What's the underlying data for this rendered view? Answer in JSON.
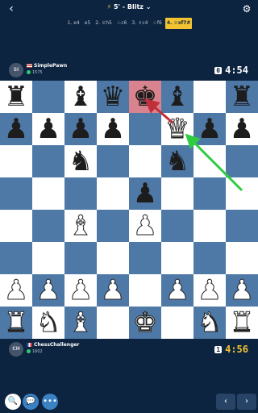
{
  "header": {
    "back_icon": "chevron-left-icon",
    "title": "5' - Blitz",
    "title_icon": "lightning-icon",
    "settings_icon": "gear-icon"
  },
  "moves": [
    "1. e4",
    "e5",
    "2. ♕h5",
    "♘c6",
    "3. ♗c4",
    "♘f6",
    "4. ♕xf7#"
  ],
  "moves_active_index": 6,
  "opponent": {
    "initials": "SI",
    "name": "SimplePawn",
    "flag": "us",
    "rating": "1575",
    "clock": "4:54",
    "clock_badge": "0"
  },
  "player": {
    "initials": "CH",
    "name": "ChessChallenger",
    "flag": "fr",
    "rating": "1602",
    "clock": "4:56",
    "clock_badge": "1"
  },
  "board": {
    "rows": [
      [
        "r",
        "",
        "b",
        "q",
        "k",
        "b",
        "",
        "r"
      ],
      [
        "p",
        "p",
        "p",
        "p",
        "",
        "Q",
        "p",
        "p"
      ],
      [
        "",
        "",
        "n",
        "",
        "",
        "n",
        "",
        ""
      ],
      [
        "",
        "",
        "",
        "",
        "p",
        "",
        "",
        ""
      ],
      [
        "",
        "",
        "B",
        "",
        "P",
        "",
        "",
        ""
      ],
      [
        "",
        "",
        "",
        "",
        "",
        "",
        "",
        ""
      ],
      [
        "P",
        "P",
        "P",
        "P",
        "",
        "P",
        "P",
        "P"
      ],
      [
        "R",
        "N",
        "B",
        "",
        "K",
        "",
        "N",
        "R"
      ]
    ],
    "highlight": "e8",
    "colors": {
      "light": "#ffffff",
      "dark": "#4e78a6",
      "highlight": "#d9838e",
      "arrow_red": "#c0303a",
      "arrow_green": "#2ecc40"
    }
  },
  "bottom": {
    "search_icon": "search-icon",
    "chat_icon": "chat-icon",
    "more_icon": "more-icon",
    "prev_icon": "chevron-left-icon",
    "next_icon": "chevron-right-icon"
  }
}
